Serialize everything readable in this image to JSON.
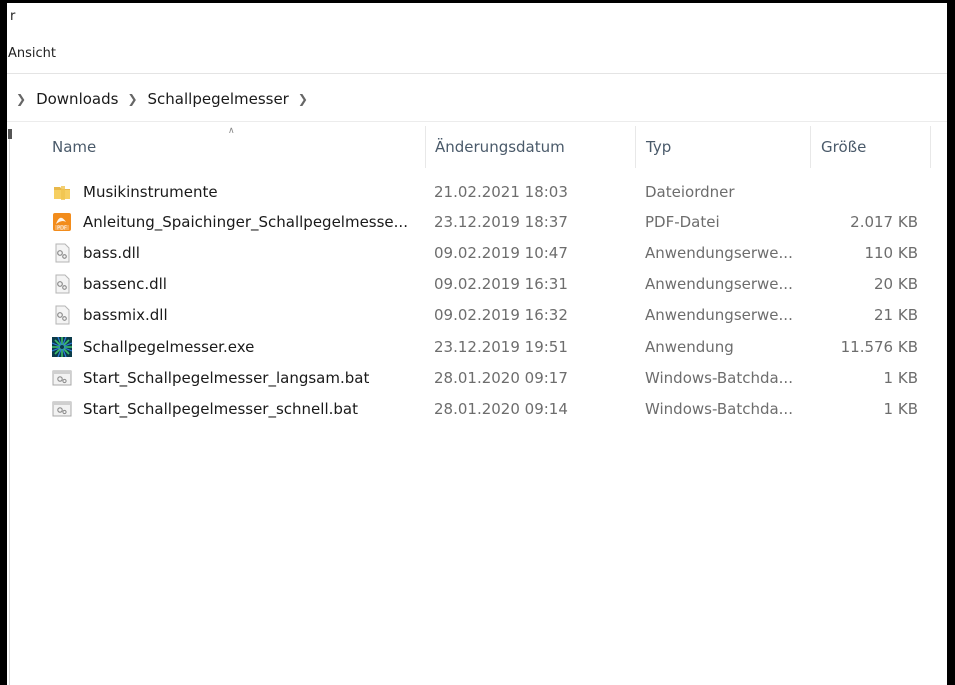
{
  "window": {
    "title_fragment": "r"
  },
  "menu": {
    "view_label": "Ansicht"
  },
  "breadcrumb": {
    "segments": [
      "Downloads",
      "Schallpegelmesser"
    ]
  },
  "columns": {
    "name": "Name",
    "date": "Änderungsdatum",
    "type": "Typ",
    "size": "Größe"
  },
  "files": [
    {
      "name": "Musikinstrumente",
      "date": "21.02.2021 18:03",
      "type": "Dateiordner",
      "size": "",
      "icon": "folder-icon"
    },
    {
      "name": "Anleitung_Spaichinger_Schallpegelmesse...",
      "date": "23.12.2019 18:37",
      "type": "PDF-Datei",
      "size": "2.017 KB",
      "icon": "pdf-icon"
    },
    {
      "name": "bass.dll",
      "date": "09.02.2019 10:47",
      "type": "Anwendungserwe...",
      "size": "110 KB",
      "icon": "dll-icon"
    },
    {
      "name": "bassenc.dll",
      "date": "09.02.2019 16:31",
      "type": "Anwendungserwe...",
      "size": "20 KB",
      "icon": "dll-icon"
    },
    {
      "name": "bassmix.dll",
      "date": "09.02.2019 16:32",
      "type": "Anwendungserwe...",
      "size": "21 KB",
      "icon": "dll-icon"
    },
    {
      "name": "Schallpegelmesser.exe",
      "date": "23.12.2019 19:51",
      "type": "Anwendung",
      "size": "11.576 KB",
      "icon": "app-icon"
    },
    {
      "name": "Start_Schallpegelmesser_langsam.bat",
      "date": "28.01.2020 09:17",
      "type": "Windows-Batchda...",
      "size": "1 KB",
      "icon": "batch-icon"
    },
    {
      "name": "Start_Schallpegelmesser_schnell.bat",
      "date": "28.01.2020 09:14",
      "type": "Windows-Batchda...",
      "size": "1 KB",
      "icon": "batch-icon"
    }
  ]
}
